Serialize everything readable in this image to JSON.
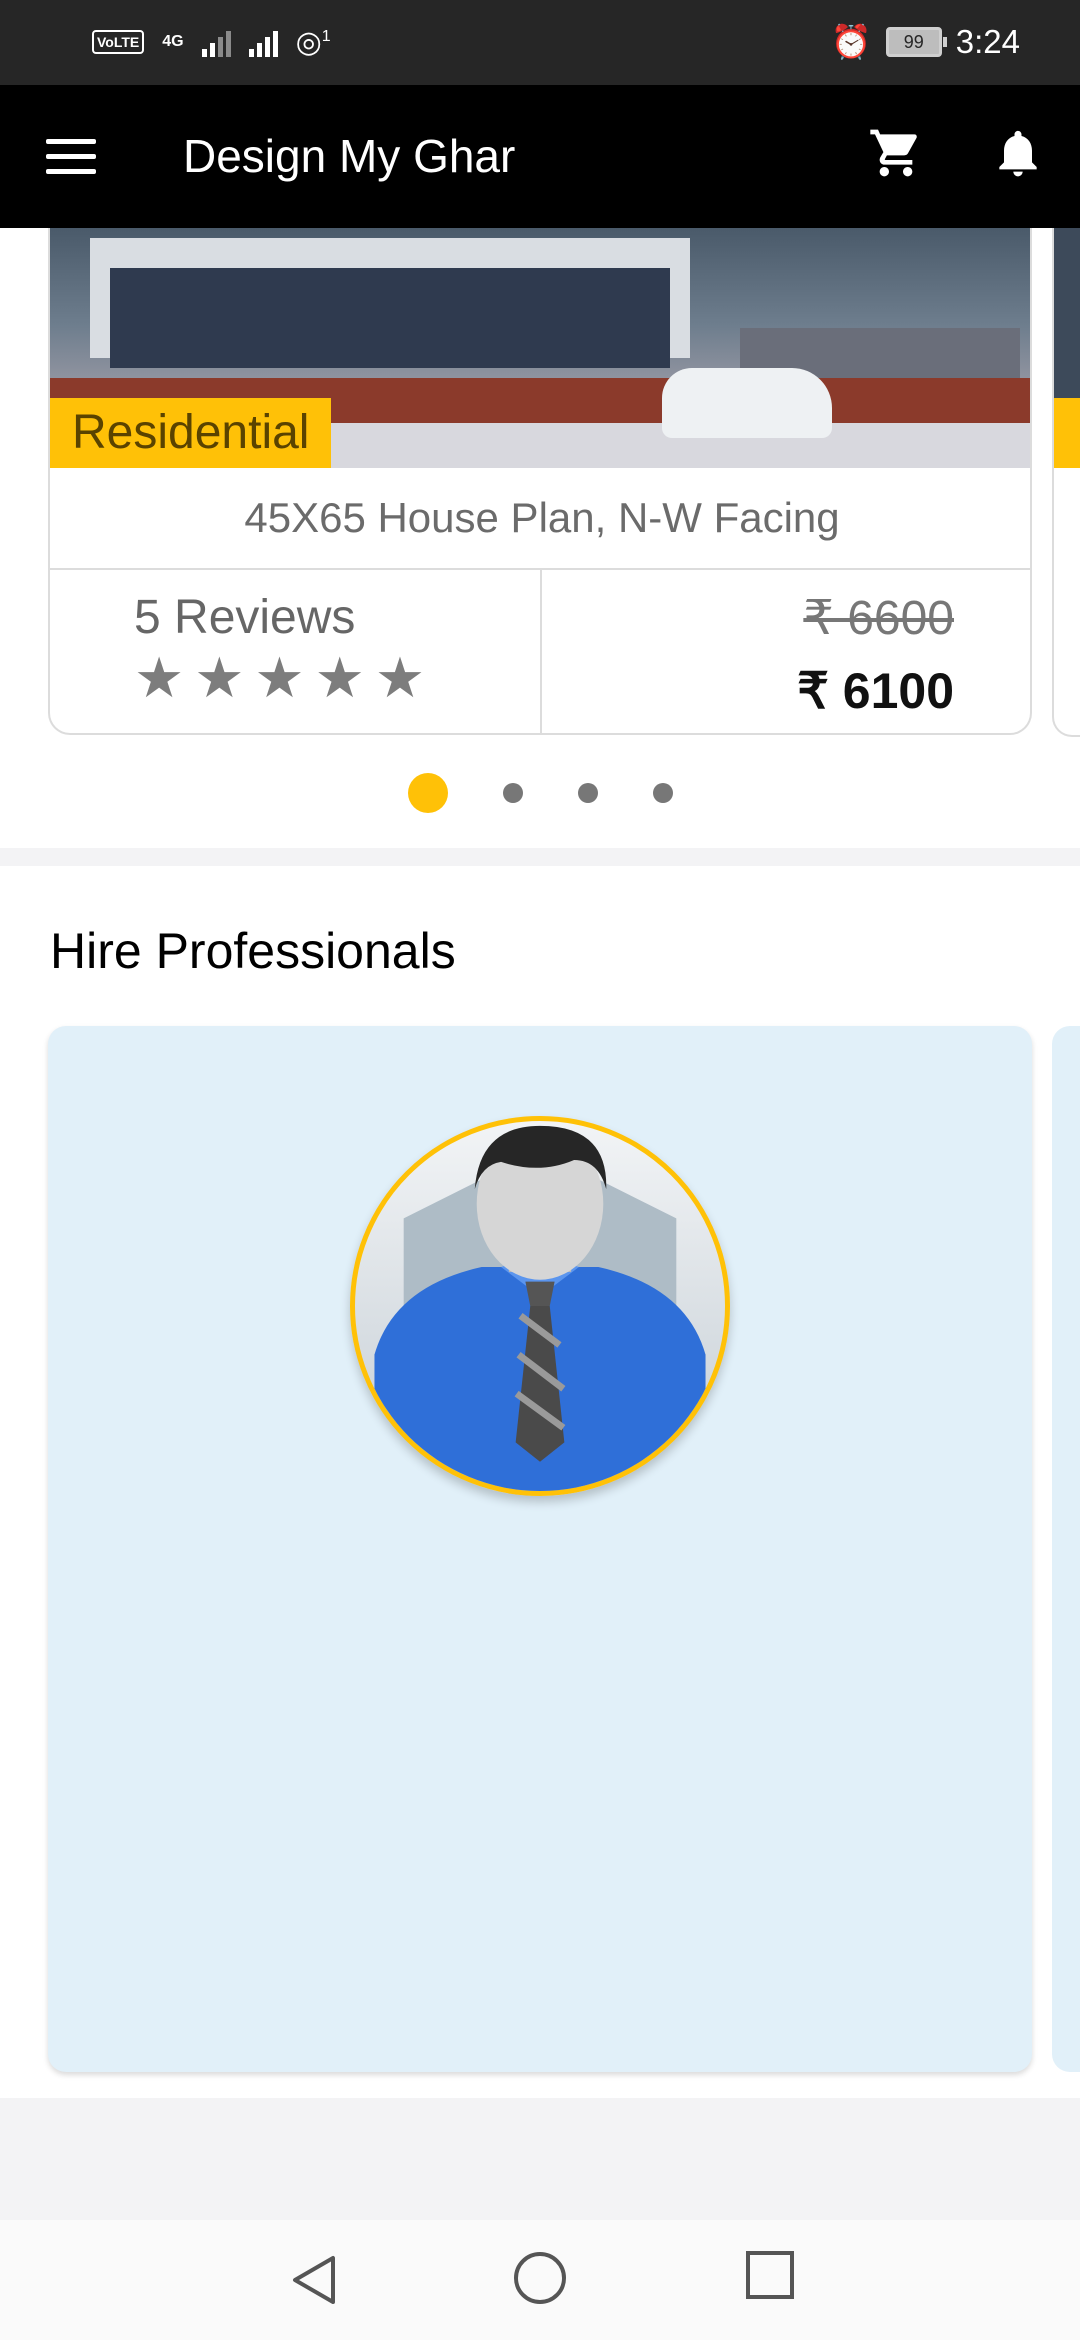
{
  "status_bar": {
    "volte_label": "VoLTE",
    "network_label": "4G",
    "hotspot_count": "1",
    "battery": "99",
    "time": "3:24"
  },
  "app_bar": {
    "title": "Design My Ghar",
    "icons": [
      "menu-icon",
      "cart-icon",
      "bell-icon"
    ]
  },
  "featured": {
    "badge": "Residential",
    "name": "45X65 House Plan, N-W Facing",
    "reviews": "5 Reviews",
    "rating": 5,
    "old_price": "₹ 6600",
    "new_price": "₹ 6100",
    "pages": 4,
    "active_page": 1
  },
  "hire": {
    "title": "Hire Professionals"
  },
  "colors": {
    "accent": "#ffc107",
    "app_bar": "#000000",
    "status_bar": "#262626",
    "card_bg": "#e1f0f9"
  },
  "nav": {
    "icons": [
      "back-icon",
      "home-icon",
      "recent-apps-icon"
    ]
  }
}
